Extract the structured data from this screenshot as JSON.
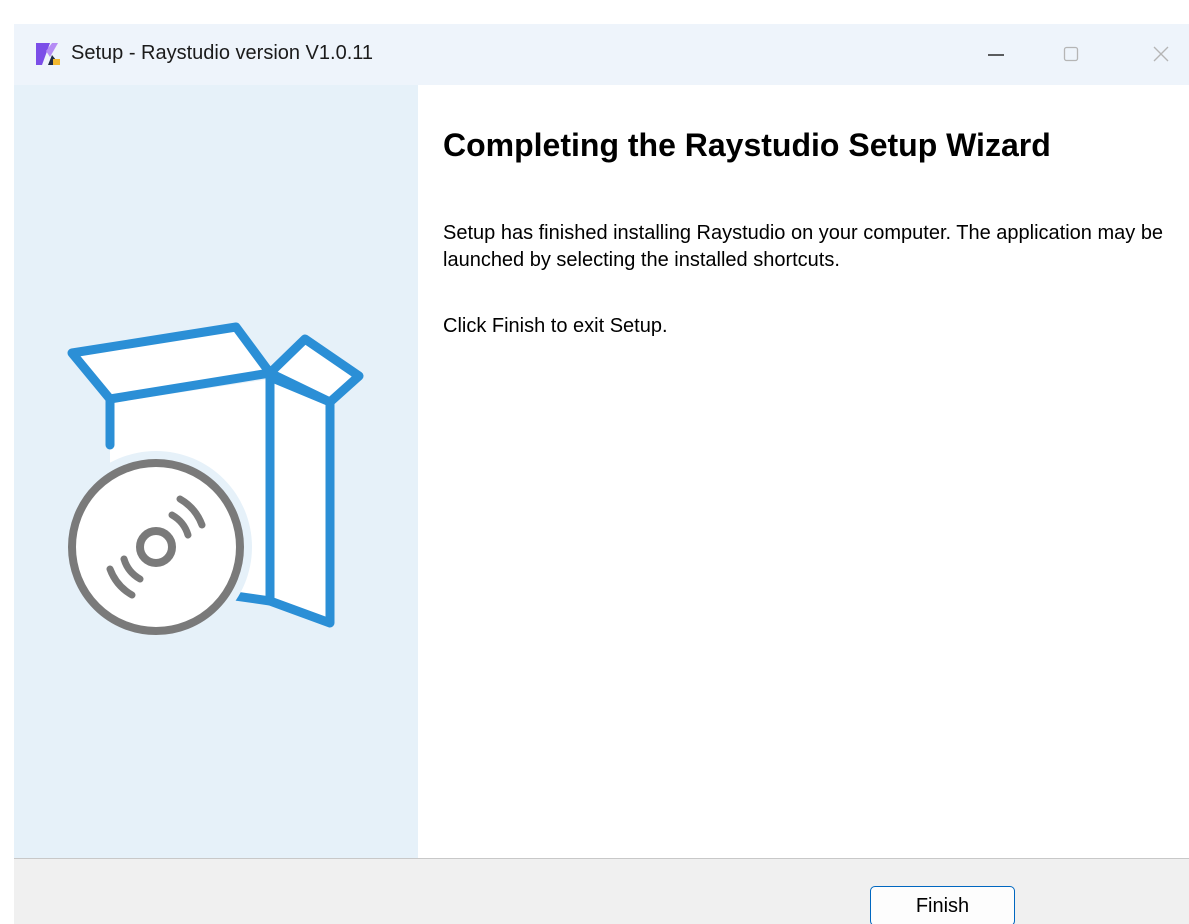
{
  "window": {
    "title": "Setup - Raystudio version V1.0.11",
    "app_icon": "raystudio-app-icon",
    "controls": {
      "minimize_icon": "minimize-icon",
      "maximize_icon": "maximize-icon",
      "close_icon": "close-icon"
    }
  },
  "sidebar": {
    "illustration": "box-with-disc-icon",
    "colors": {
      "background": "#e6f1f9",
      "box_stroke": "#2b8fd6",
      "disc": "#7a7a7a"
    }
  },
  "main": {
    "heading": "Completing the Raystudio Setup Wizard",
    "paragraph1": "Setup has finished installing Raystudio on your computer. The application may be launched by selecting the installed shortcuts.",
    "paragraph2": "Click Finish to exit Setup."
  },
  "footer": {
    "finish_label": "Finish"
  },
  "colors": {
    "accent": "#0067c0",
    "titlebar": "#eef4fb"
  }
}
